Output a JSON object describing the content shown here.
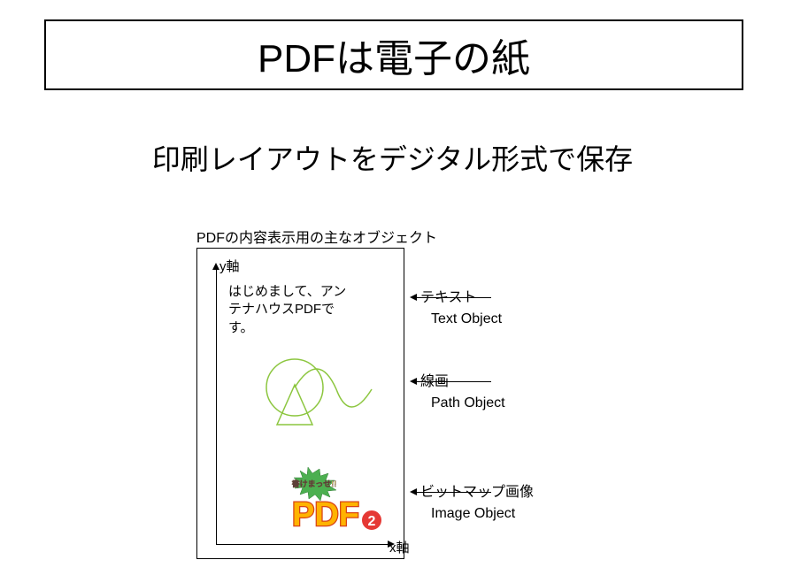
{
  "title": "PDFは電子の紙",
  "subtitle": "印刷レイアウトをデジタル形式で保存",
  "diagram": {
    "caption": "PDFの内容表示用の主なオブジェクト",
    "y_axis_label": "y軸",
    "x_axis_label": "x軸",
    "sample_text": "はじめまして、アンテナハウスPDFです。",
    "logo_top_text": "書けまっせ!!",
    "logo_main_text": "PDF",
    "logo_badge_number": "2"
  },
  "callouts": {
    "text": {
      "jp": "テキスト",
      "en": "Text Object"
    },
    "path": {
      "jp": "線画",
      "en": "Path Object"
    },
    "image": {
      "jp": "ビットマップ画像",
      "en": "Image Object"
    }
  }
}
